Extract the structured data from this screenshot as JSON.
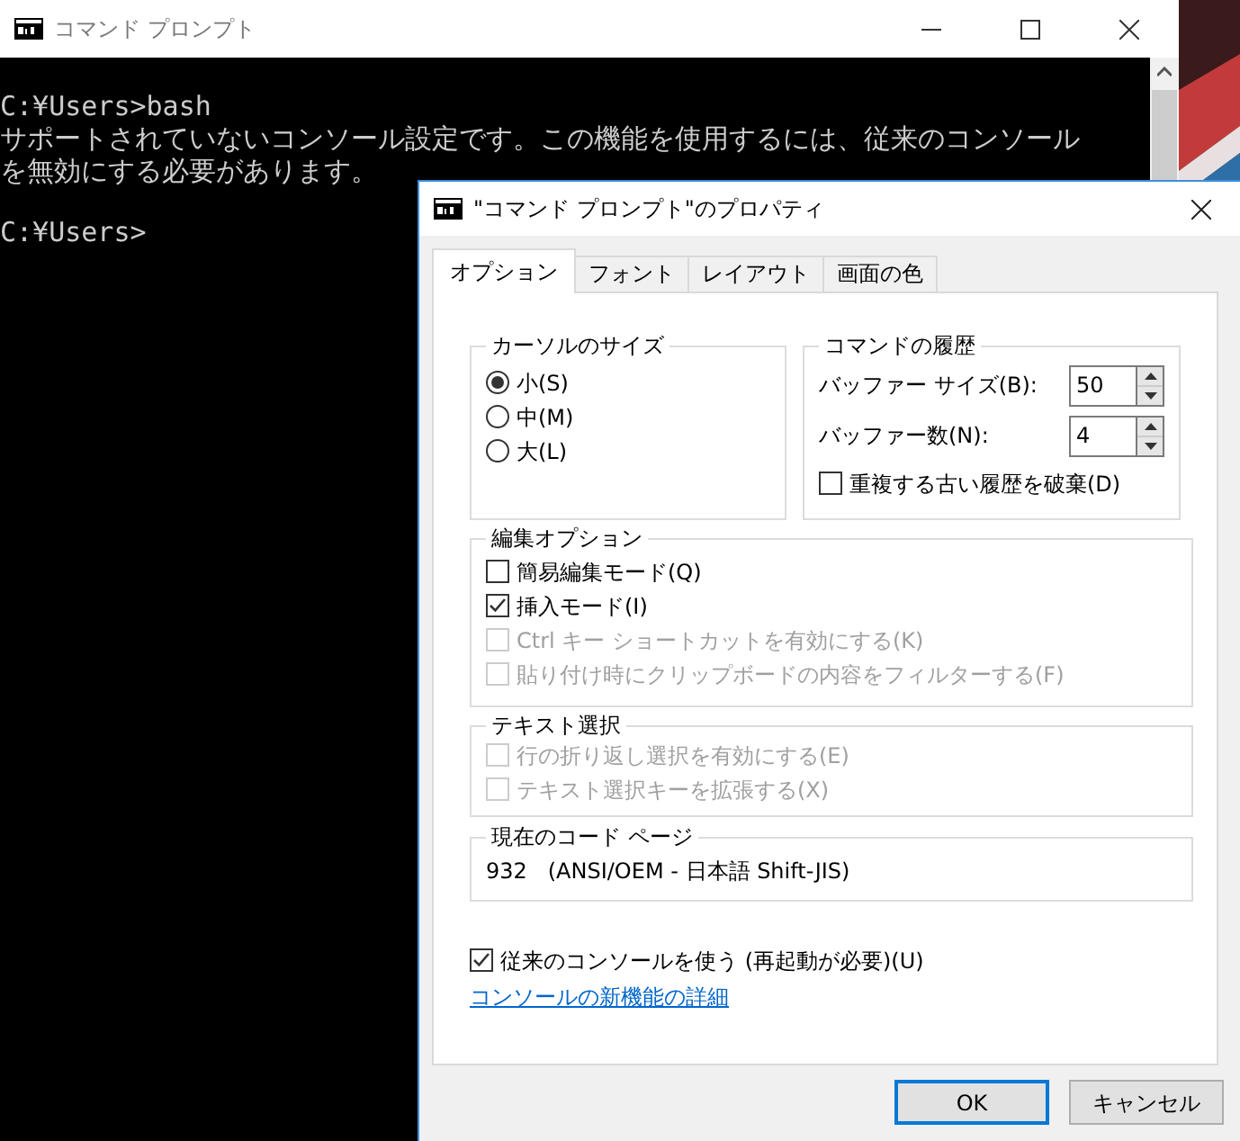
{
  "console_window": {
    "title": "コマンド プロンプト",
    "lines": [
      {
        "text": "C:¥Users>bash",
        "gap_before": false
      },
      {
        "text": "サポートされていないコンソール設定です。この機能を使用するには、従来のコンソール",
        "gap_before": false
      },
      {
        "text": "を無効にする必要があります。",
        "gap_before": false
      },
      {
        "text": "C:¥Users>",
        "gap_before": true
      }
    ]
  },
  "dialog": {
    "title": "\"コマンド プロンプト\"のプロパティ",
    "tabs": [
      {
        "label": "オプション",
        "selected": true
      },
      {
        "label": "フォント",
        "selected": false
      },
      {
        "label": "レイアウト",
        "selected": false
      },
      {
        "label": "画面の色",
        "selected": false
      }
    ],
    "cursor_size": {
      "title": "カーソルのサイズ",
      "options": [
        {
          "label": "小(S)",
          "selected": true
        },
        {
          "label": "中(M)",
          "selected": false
        },
        {
          "label": "大(L)",
          "selected": false
        }
      ]
    },
    "command_history": {
      "title": "コマンドの履歴",
      "fields": [
        {
          "label": "バッファー サイズ(B):",
          "value": "50"
        },
        {
          "label": "バッファー数(N):",
          "value": "4"
        }
      ],
      "discard_duplicates": {
        "label": "重複する古い履歴を破棄(D)",
        "checked": false,
        "disabled": false
      }
    },
    "edit_options": {
      "title": "編集オプション",
      "options": [
        {
          "label": "簡易編集モード(Q)",
          "checked": false,
          "disabled": false
        },
        {
          "label": "挿入モード(I)",
          "checked": true,
          "disabled": false
        },
        {
          "label": "Ctrl キー ショートカットを有効にする(K)",
          "checked": false,
          "disabled": true
        },
        {
          "label": "貼り付け時にクリップボードの内容をフィルターする(F)",
          "checked": false,
          "disabled": true
        }
      ]
    },
    "text_selection": {
      "title": "テキスト選択",
      "options": [
        {
          "label": "行の折り返し選択を有効にする(E)",
          "checked": false,
          "disabled": true
        },
        {
          "label": "テキスト選択キーを拡張する(X)",
          "checked": false,
          "disabled": true
        }
      ]
    },
    "code_page": {
      "title": "現在のコード ページ",
      "value": "932   (ANSI/OEM - 日本語 Shift-JIS)"
    },
    "legacy_console": {
      "label": "従来のコンソールを使う (再起動が必要)(U)",
      "checked": true,
      "disabled": false
    },
    "link": "コンソールの新機能の詳細",
    "buttons": [
      {
        "label": "OK",
        "default": true
      },
      {
        "label": "キャンセル",
        "default": false
      }
    ]
  }
}
